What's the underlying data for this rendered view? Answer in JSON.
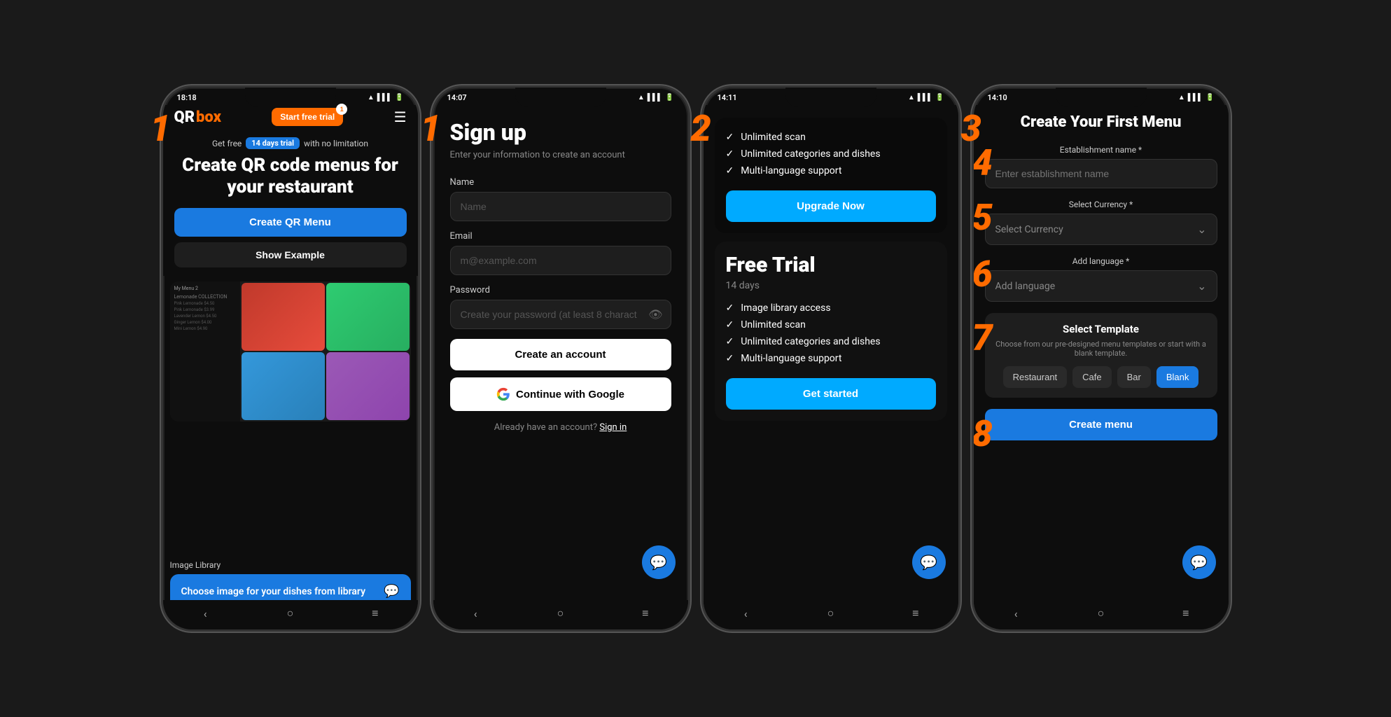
{
  "phones": [
    {
      "id": "phone1",
      "step": "1",
      "step_position": "top-left",
      "status_time": "18:18",
      "header": {
        "logo_qr": "QR",
        "logo_box": "box",
        "trial_button": "Start free trial",
        "trial_notification": "1"
      },
      "hero": {
        "get_free": "Get free",
        "days_badge": "14 days trial",
        "no_limitation": "with no limitation",
        "title": "Create QR code menus for your restaurant",
        "create_btn": "Create QR Menu",
        "example_btn": "Show Example"
      },
      "image_library": {
        "label": "Image Library",
        "card_text": "Choose image for your dishes from library"
      }
    },
    {
      "id": "phone2",
      "step": "1",
      "step_position": "top-left",
      "status_time": "14:07",
      "signup": {
        "title": "Sign up",
        "subtitle": "Enter your information to create an account",
        "name_label": "Name",
        "name_placeholder": "Name",
        "email_label": "Email",
        "email_placeholder": "m@example.com",
        "password_label": "Password",
        "password_placeholder": "Create your password (at least 8 charact",
        "create_account_btn": "Create an account",
        "google_btn": "Continue with Google",
        "signin_text": "Already have an account?",
        "signin_link": "Sign in"
      }
    },
    {
      "id": "phone3",
      "step": "2",
      "step_position": "top-left",
      "status_time": "14:11",
      "paid_plan": {
        "features": [
          "Unlimited scan",
          "Unlimited categories and dishes",
          "Multi-language support"
        ],
        "upgrade_btn": "Upgrade Now"
      },
      "free_trial": {
        "title": "Free Trial",
        "days": "14 days",
        "features": [
          "Image library access",
          "Unlimited scan",
          "Unlimited categories and dishes",
          "Multi-language support"
        ],
        "get_started_btn": "Get started"
      }
    },
    {
      "id": "phone4",
      "step": "3",
      "step_position": "top-left",
      "status_time": "14:10",
      "create_menu": {
        "title": "Create Your First Menu",
        "establishment_label": "Establishment name *",
        "establishment_placeholder": "Enter establishment name",
        "currency_label": "Select Currency *",
        "currency_placeholder": "Select Currency",
        "language_label": "Add language *",
        "language_placeholder": "Add language",
        "template_title": "Select Template",
        "template_desc": "Choose from our pre-designed menu templates or start with a blank template.",
        "templates": [
          "Restaurant",
          "Cafe",
          "Bar",
          "Blank"
        ],
        "active_template": "Blank",
        "create_btn": "Create menu",
        "step_labels": {
          "4": "4",
          "5": "5",
          "6": "6",
          "7": "7",
          "8": "8"
        }
      }
    }
  ],
  "colors": {
    "orange": "#FF6B00",
    "blue": "#1a7ae0",
    "cyan": "#00aaff",
    "dark_bg": "#0d0d0d",
    "card_bg": "#1e1e1e"
  }
}
